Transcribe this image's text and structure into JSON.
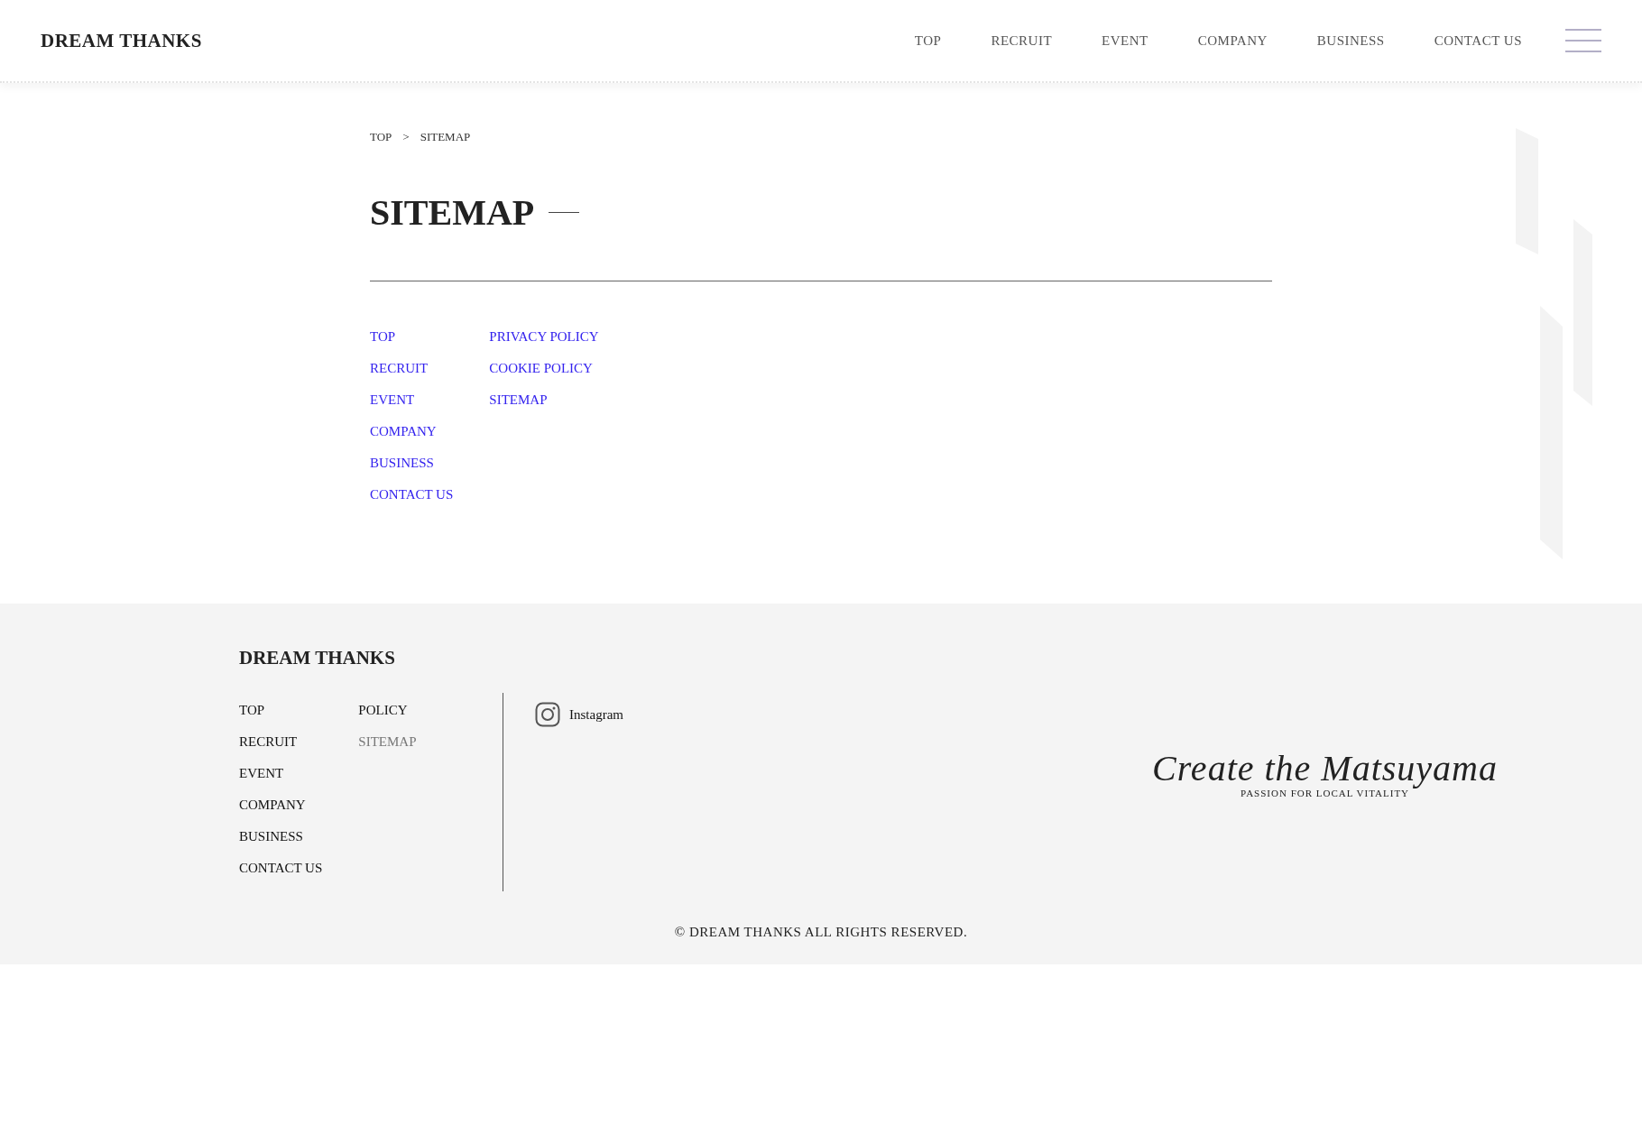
{
  "header": {
    "logo": "DREAM THANKS",
    "nav": [
      "TOP",
      "RECRUIT",
      "EVENT",
      "COMPANY",
      "BUSINESS",
      "CONTACT US"
    ]
  },
  "breadcrumb": [
    "TOP",
    ">",
    "SITEMAP"
  ],
  "page_title": "SITEMAP",
  "sitemap_columns": [
    [
      "TOP",
      "RECRUIT",
      "EVENT",
      "COMPANY",
      "BUSINESS",
      "CONTACT US"
    ],
    [
      "PRIVACY POLICY",
      "COOKIE POLICY",
      "SITEMAP"
    ]
  ],
  "footer": {
    "logo": "DREAM THANKS",
    "link_columns": [
      [
        {
          "label": "TOP",
          "selected": false
        },
        {
          "label": "RECRUIT",
          "selected": false
        },
        {
          "label": "EVENT",
          "selected": false
        },
        {
          "label": "COMPANY",
          "selected": false
        },
        {
          "label": "BUSINESS",
          "selected": false
        },
        {
          "label": "CONTACT US",
          "selected": false
        }
      ],
      [
        {
          "label": "POLICY",
          "selected": false
        },
        {
          "label": "SITEMAP",
          "selected": true
        }
      ]
    ],
    "social": "Instagram",
    "slogan": "Create the Matsuyama",
    "tagline": "PASSION FOR LOCAL VITALITY",
    "copyright": "© DREAM THANKS ALL RIGHTS RESERVED."
  }
}
